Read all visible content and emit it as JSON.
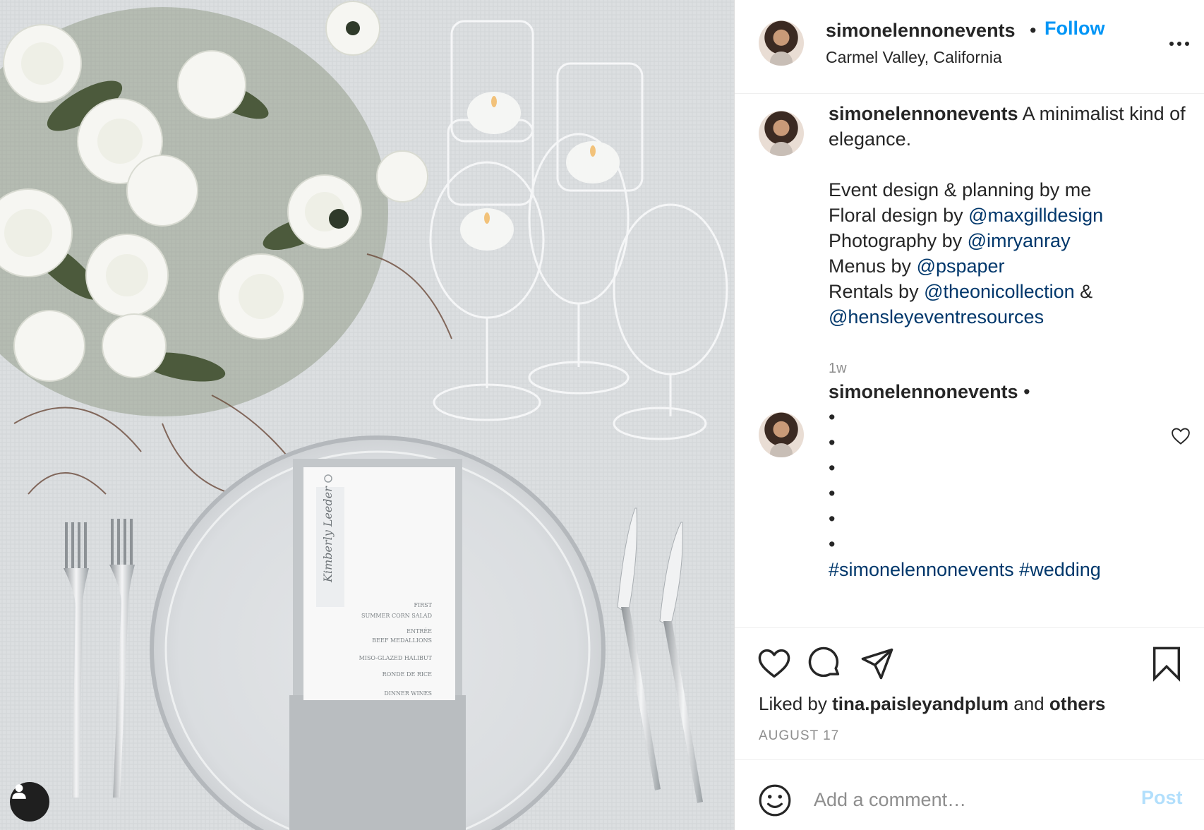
{
  "post": {
    "username": "simonelennonevents",
    "follow_label": "Follow",
    "separator_dot": "•",
    "location": "Carmel Valley, California"
  },
  "caption": {
    "username": "simonelennonevents",
    "text_line1": "A minimalist kind of elegance.",
    "credits": [
      {
        "prefix": "Event design & planning by me",
        "mention": "",
        "suffix": ""
      },
      {
        "prefix": "Floral design by ",
        "mention": "@maxgilldesign",
        "suffix": ""
      },
      {
        "prefix": "Photography by ",
        "mention": "@imryanray",
        "suffix": ""
      },
      {
        "prefix": "Menus by ",
        "mention": "@pspaper",
        "suffix": ""
      },
      {
        "prefix": "Rentals by ",
        "mention": "@theonicollection",
        "suffix": " &"
      },
      {
        "prefix": "",
        "mention": "@hensleyeventresources",
        "suffix": ""
      }
    ],
    "age": "1w"
  },
  "comment": {
    "username": "simonelennonevents",
    "separator_dot": "•",
    "bullets": [
      "•",
      "•",
      "•",
      "•",
      "•",
      "•"
    ],
    "hashtags": "#simonelennonevents #wedding"
  },
  "likes": {
    "prefix": "Liked by ",
    "user": "tina.paisleyandplum",
    "middle": " and ",
    "others": "others"
  },
  "date": "AUGUST 17",
  "comment_box": {
    "placeholder": "Add a comment…",
    "post_label": "Post"
  },
  "icons": {
    "more": "more-horizontal-icon",
    "like": "heart-icon",
    "comment": "comment-bubble-icon",
    "share": "paper-plane-icon",
    "save": "bookmark-icon",
    "emoji": "smiley-icon",
    "user_tag": "user-tag-icon"
  },
  "colors": {
    "follow": "#0095f6",
    "mention": "#00376b",
    "muted": "#8e8e8e",
    "post_disabled": "#b2dffc"
  },
  "photo_menu": {
    "menu_lines": [
      "FIRST",
      "SUMMER CORN SALAD",
      "ENTRÉE",
      "BEEF MEDALLIONS",
      "MISO-GLAZED HALIBUT",
      "RONDE DE RICE",
      "DINNER WINES"
    ],
    "place_card_name": "Kimberly Leeder"
  }
}
